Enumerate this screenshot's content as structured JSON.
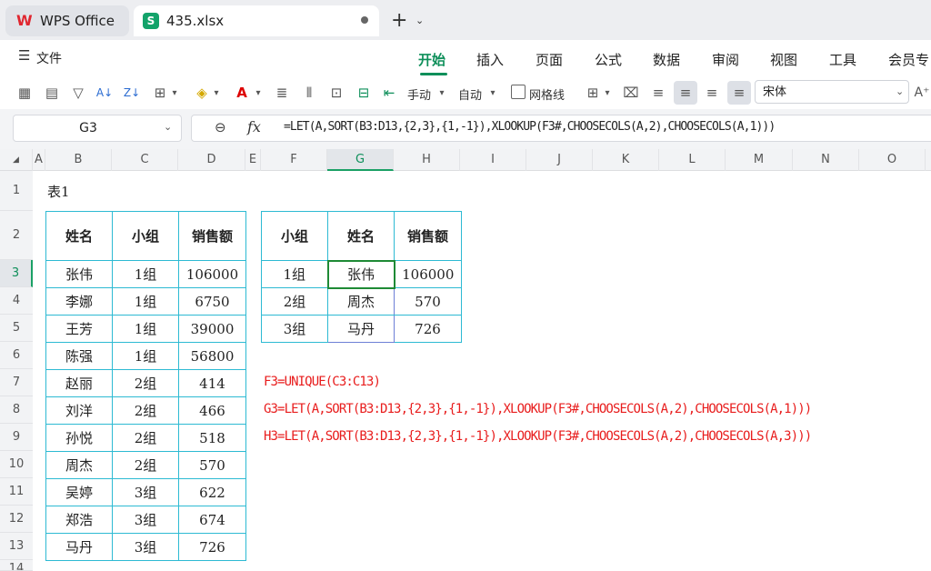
{
  "tabs": [
    {
      "label": "WPS Office"
    },
    {
      "label": "435.xlsx"
    }
  ],
  "menu": {
    "file_label": "文件",
    "tabs": [
      "开始",
      "插入",
      "页面",
      "公式",
      "数据",
      "审阅",
      "视图",
      "工具",
      "会员专"
    ]
  },
  "toolbar": {
    "manual_label": "手动",
    "auto_label": "自动",
    "gridlines_label": "网格线",
    "font_name": "宋体"
  },
  "formula_bar": {
    "cell_ref": "G3",
    "formula": "=LET(A,SORT(B3:D13,{2,3},{1,-1}),XLOOKUP(F3#,CHOOSECOLS(A,2),CHOOSECOLS(A,1)))"
  },
  "columns": [
    "A",
    "B",
    "C",
    "D",
    "E",
    "F",
    "G",
    "H",
    "I",
    "J",
    "K",
    "L",
    "M",
    "N",
    "O"
  ],
  "rows": [
    "1",
    "2",
    "3",
    "4",
    "5",
    "6",
    "7",
    "8",
    "9",
    "10",
    "11",
    "12",
    "13",
    "14"
  ],
  "sheet": {
    "title": "表1",
    "table1": {
      "headers": [
        "姓名",
        "小组",
        "销售额"
      ],
      "rows": [
        [
          "张伟",
          "1组",
          "106000"
        ],
        [
          "李娜",
          "1组",
          "6750"
        ],
        [
          "王芳",
          "1组",
          "39000"
        ],
        [
          "陈强",
          "1组",
          "56800"
        ],
        [
          "赵丽",
          "2组",
          "414"
        ],
        [
          "刘洋",
          "2组",
          "466"
        ],
        [
          "孙悦",
          "2组",
          "518"
        ],
        [
          "周杰",
          "2组",
          "570"
        ],
        [
          "吴婷",
          "3组",
          "622"
        ],
        [
          "郑浩",
          "3组",
          "674"
        ],
        [
          "马丹",
          "3组",
          "726"
        ]
      ]
    },
    "table2": {
      "headers": [
        "小组",
        "姓名",
        "销售额"
      ],
      "rows": [
        [
          "1组",
          "张伟",
          "106000"
        ],
        [
          "2组",
          "周杰",
          "570"
        ],
        [
          "3组",
          "马丹",
          "726"
        ]
      ]
    },
    "notes": [
      "F3=UNIQUE(C3:C13)",
      "G3=LET(A,SORT(B3:D13,{2,3},{1,-1}),XLOOKUP(F3#,CHOOSECOLS(A,2),CHOOSECOLS(A,1)))",
      "H3=LET(A,SORT(B3:D13,{2,3},{1,-1}),XLOOKUP(F3#,CHOOSECOLS(A,2),CHOOSECOLS(A,3)))"
    ]
  },
  "colors": {
    "accent": "#0e8f5a",
    "table_border": "#2dbad3",
    "note_text": "#e81d1d"
  }
}
